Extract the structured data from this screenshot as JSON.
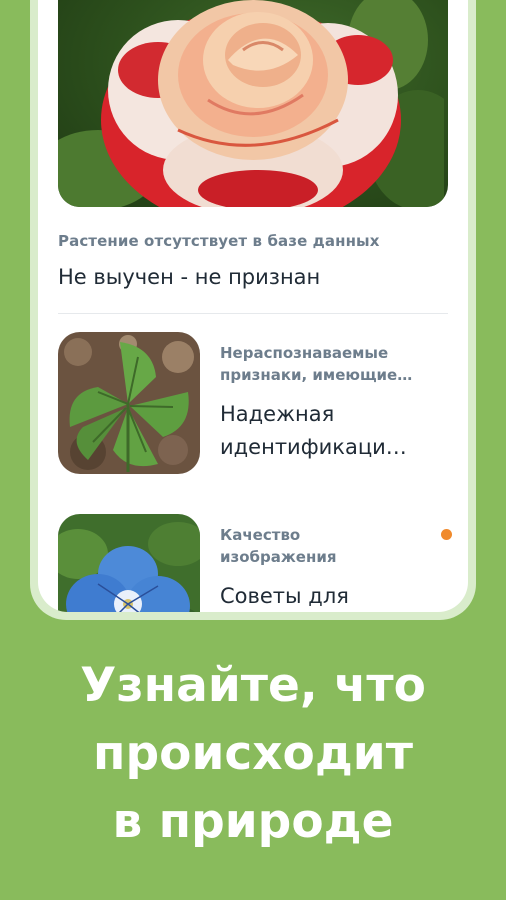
{
  "feed": {
    "featured": {
      "image_icon": "rose-photo",
      "subtitle": "Растение отсутствует в базе данных",
      "title": "Не выучен - не признан"
    },
    "items": [
      {
        "image_icon": "strawberry-leaf-photo",
        "category_line1": "Нераспознаваемые",
        "category_line2": "признаки, имеющие…",
        "title_line1": "Надежная",
        "title_line2": "идентификаци…",
        "unread": false
      },
      {
        "image_icon": "speedwell-flower-photo",
        "category_line1": "Качество",
        "category_line2": "изображения",
        "title_line1": "Советы для",
        "unread": true,
        "unread_color": "#f08a2c"
      }
    ]
  },
  "tagline": {
    "line1": "Узнайте, что",
    "line2": "происходит",
    "line3": "в природе"
  },
  "colors": {
    "background": "#89bb5c",
    "frame": "#d9eccb",
    "subtitle": "#6d7d8c",
    "title": "#202b36"
  }
}
